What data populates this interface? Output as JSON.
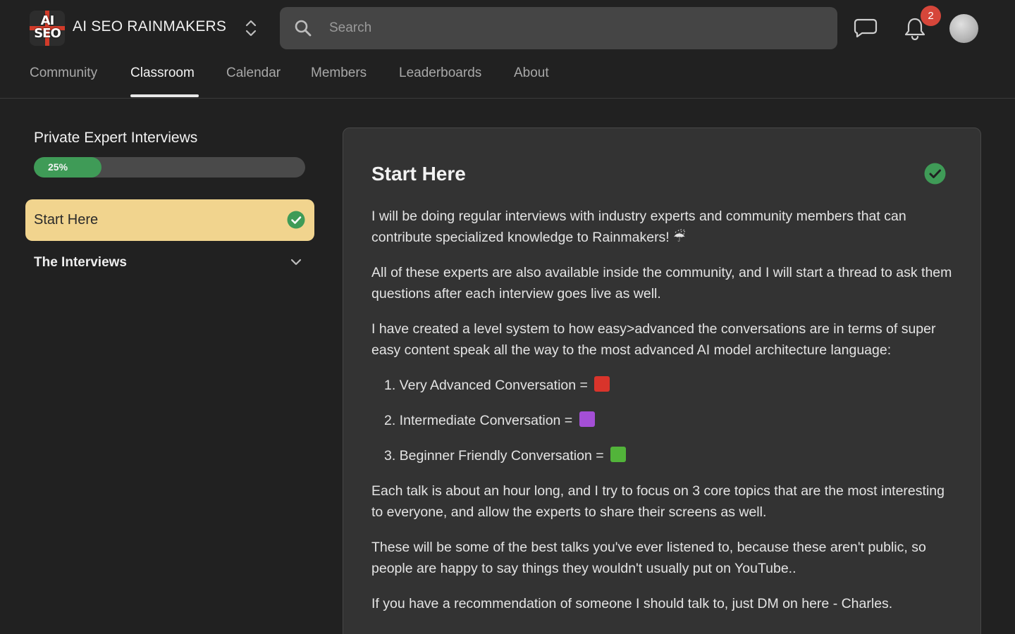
{
  "header": {
    "logo_lines": [
      "AI",
      "SEO"
    ],
    "brand": "AI SEO RAINMAKERS",
    "search": {
      "placeholder": "Search",
      "value": ""
    },
    "notification_count": "2",
    "icons": [
      "switcher-icon",
      "search-icon",
      "chat-icon",
      "bell-icon"
    ]
  },
  "nav": {
    "items": [
      {
        "label": "Community",
        "active": false
      },
      {
        "label": "Classroom",
        "active": true
      },
      {
        "label": "Calendar",
        "active": false
      },
      {
        "label": "Members",
        "active": false
      },
      {
        "label": "Leaderboards",
        "active": false
      },
      {
        "label": "About",
        "active": false
      }
    ]
  },
  "sidebar": {
    "course_title": "Private Expert Interviews",
    "progress": {
      "label": "25%",
      "value": 0.25
    },
    "lessons": [
      {
        "label": "Start Here",
        "completed": true,
        "active": true
      }
    ],
    "sections": [
      {
        "label": "The Interviews",
        "expanded": false
      }
    ]
  },
  "content": {
    "title": "Start Here",
    "completed": true,
    "paragraphs": [
      "I will be doing regular interviews with industry experts and community members that can contribute specialized knowledge to Rainmakers! ☔",
      "All of these experts are also available inside the community, and I will start a thread to ask them questions after each interview goes live as well.",
      "I have created a level system to how easy>advanced the conversations are in terms of super easy content speak all the way to the most advanced AI model architecture language:",
      "Each talk is about an hour long, and I try to focus on 3 core topics that are the most interesting to everyone, and allow the experts to share their screens as well.",
      "These will be some of the best talks you've ever listened to, because these aren't public, so people are happy to say things they wouldn't usually put on YouTube..",
      "If you have a recommendation of someone I should talk to, just DM on here - Charles."
    ],
    "levels": [
      {
        "text": "1. Very Advanced Conversation =",
        "color": "#d9342b"
      },
      {
        "text": "2. Intermediate Conversation =",
        "color": "#a44fd6"
      },
      {
        "text": "3. Beginner Friendly Conversation =",
        "color": "#52b43a"
      }
    ]
  },
  "colors": {
    "background": "#212121",
    "card": "#333333",
    "accent_green": "#3f9b57",
    "active_lesson": "#f1d48e",
    "badge_red": "#d6463a"
  }
}
